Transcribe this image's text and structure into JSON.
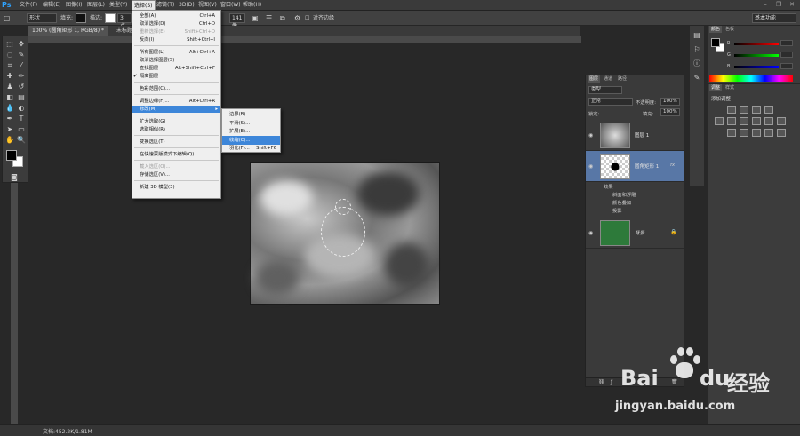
{
  "menubar": {
    "logo": "Ps",
    "items": [
      "文件(F)",
      "编辑(E)",
      "图像(I)",
      "图层(L)",
      "类型(Y)",
      "选择(S)",
      "滤镜(T)",
      "3D(D)",
      "视图(V)",
      "窗口(W)",
      "帮助(H)"
    ]
  },
  "options": {
    "shape_mode": "形状",
    "fill_label": "填充:",
    "stroke_label": "描边:",
    "stroke_width": "3 点",
    "height_value": "141 像",
    "align_edges": "对齐边缘",
    "workspace": "基本功能"
  },
  "doc_tab": {
    "title": "100% (圆角矩形 1, RGB/8) *",
    "second": "未标题"
  },
  "dropdown": {
    "items": [
      {
        "label": "全部(A)",
        "shortcut": "Ctrl+A"
      },
      {
        "label": "取消选择(D)",
        "shortcut": "Ctrl+D"
      },
      {
        "label": "重新选择(E)",
        "shortcut": "Shift+Ctrl+D"
      },
      {
        "label": "反向(I)",
        "shortcut": "Shift+Ctrl+I"
      },
      {
        "label": "所有图层(L)",
        "shortcut": "Alt+Ctrl+A"
      },
      {
        "label": "取消选择图层(S)",
        "shortcut": ""
      },
      {
        "label": "查找图层",
        "shortcut": "Alt+Shift+Ctrl+F"
      },
      {
        "label": "隔离图层",
        "shortcut": ""
      },
      {
        "label": "色彩范围(C)...",
        "shortcut": ""
      },
      {
        "label": "调整边缘(F)...",
        "shortcut": "Alt+Ctrl+R"
      },
      {
        "label": "修改(M)",
        "shortcut": ""
      },
      {
        "label": "扩大选取(G)",
        "shortcut": ""
      },
      {
        "label": "选取相似(R)",
        "shortcut": ""
      },
      {
        "label": "变换选区(T)",
        "shortcut": ""
      },
      {
        "label": "在快速蒙版模式下编辑(Q)",
        "shortcut": ""
      },
      {
        "label": "载入选区(O)...",
        "shortcut": ""
      },
      {
        "label": "存储选区(V)...",
        "shortcut": ""
      },
      {
        "label": "新建 3D 模型(3)",
        "shortcut": ""
      }
    ]
  },
  "submenu": {
    "items": [
      {
        "label": "边界(B)...",
        "shortcut": ""
      },
      {
        "label": "平滑(S)...",
        "shortcut": ""
      },
      {
        "label": "扩展(E)...",
        "shortcut": ""
      },
      {
        "label": "收缩(C)...",
        "shortcut": ""
      },
      {
        "label": "羽化(F)...",
        "shortcut": "Shift+F6"
      }
    ]
  },
  "color_panel": {
    "tab1": "颜色",
    "tab2": "色板",
    "r": "R",
    "g": "G",
    "b": "B"
  },
  "adjust_panel": {
    "tab1": "调整",
    "tab2": "样式",
    "title": "添加调整"
  },
  "layers": {
    "tab1": "图层",
    "tab2": "通道",
    "tab3": "路径",
    "kind": "类型",
    "blend": "正常",
    "opacity_label": "不透明度:",
    "opacity": "100%",
    "lock_label": "锁定:",
    "fill_label": "填充:",
    "fill": "100%",
    "rows": [
      {
        "name": "图层 1"
      },
      {
        "name": "圆角矩形 1"
      },
      {
        "name": "背景"
      }
    ],
    "effects_label": "效果",
    "effects": [
      "斜面和浮雕",
      "颜色叠加",
      "投影"
    ],
    "fx": "fx"
  },
  "status": {
    "text": "文档:452.2K/1.81M"
  },
  "watermark": {
    "brand": "Bai",
    "brand2": "du",
    "cn": "经验",
    "url": "jingyan.baidu.com"
  }
}
